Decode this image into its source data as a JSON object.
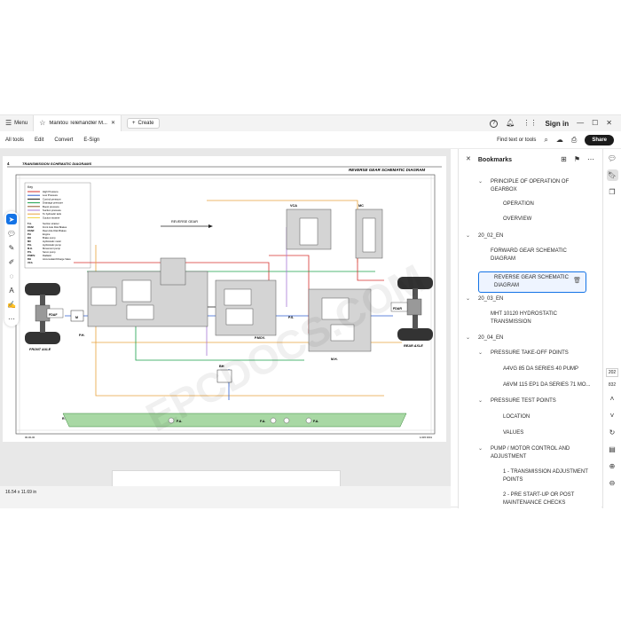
{
  "titlebar": {
    "menu_label": "Menu",
    "tab_title": "Manitou Telehandler M...",
    "create_label": "Create",
    "signin_label": "Sign in"
  },
  "toolbar": {
    "menu_items": [
      "All tools",
      "Edit",
      "Convert",
      "E-Sign"
    ],
    "find_label": "Find text or tools",
    "share_label": "Share"
  },
  "document": {
    "header_left": "TRANSMISSION SCHEMATIC DIAGRAMS",
    "header_num": "4",
    "header_right": "REVERSE GEAR SCHEMATIC DIAGRAM",
    "reverse_gear_label": "REVERSE GEAR",
    "front_axle": "FRONT AXLE",
    "rear_axle": "REAR AXLE",
    "fdaf": "FDAF",
    "fdar": "FDAR",
    "vca": "VCA",
    "mc": "MC",
    "bh": "BH",
    "ph": "P.H.",
    "pmov": "P.MOV.",
    "ps": "P.S.",
    "mh": "M.H.",
    "r": "R.",
    "fa1": "F.A.",
    "fa2": "F.A.",
    "fa3": "F.A.",
    "m": "M",
    "footer_left": "00-00-00",
    "footer_right": "1/445 0001",
    "watermark": "EPCDOCS.COM",
    "key_title": "Key",
    "key_items": [
      {
        "color": "#d6312e",
        "text": "High Pressure"
      },
      {
        "color": "#2f5fd0",
        "text": "Low Pressure"
      },
      {
        "color": "#1a1a1a",
        "text": "Control pressure"
      },
      {
        "color": "#1aa04a",
        "text": "Drainage pressure"
      },
      {
        "color": "#8c5a2b",
        "text": "Boost pressure"
      },
      {
        "color": "#a678d6",
        "text": "Suction pressure"
      },
      {
        "color": "#e7a23c",
        "text": "To hydraulic tank"
      },
      {
        "color": "#f0d23c",
        "text": "Suction strainer"
      }
    ],
    "key_abbrev": [
      "T.A.",
      "FDAF",
      "FDAR",
      "PH",
      "BH",
      "MC",
      "P.H.",
      "M.H.",
      "P.S.",
      "P.MOV.",
      "RH",
      "VCA"
    ],
    "key_abbrev_desc": [
      "Suction strainer",
      "Front Axle Disk Brakes",
      "Rear Axle Disk Brakes",
      "Engine",
      "Brake pump",
      "Hydrostatic motor",
      "Hydrostatic pump",
      "Movement pump",
      "Servo pump",
      "Radiator",
      "Accumulator/Charge Valve",
      ""
    ]
  },
  "sizeinfo": "16.54 x 11.69 in",
  "bookmarks": {
    "title": "Bookmarks",
    "items": [
      {
        "label": "PRINCIPLE OF OPERATION OF GEARBOX",
        "chev": "v",
        "indent": 1
      },
      {
        "label": "OPERATION",
        "chev": "",
        "indent": 2
      },
      {
        "label": "OVERVIEW",
        "chev": "",
        "indent": 2
      },
      {
        "label": "20_02_EN",
        "chev": "v",
        "indent": 0
      },
      {
        "label": "FORWARD GEAR SCHEMATIC DIAGRAM",
        "chev": "",
        "indent": 1
      },
      {
        "label": "REVERSE GEAR SCHEMATIC DIAGRAM",
        "chev": "",
        "indent": 1,
        "selected": true
      },
      {
        "label": "20_03_EN",
        "chev": "v",
        "indent": 0
      },
      {
        "label": "MHT 10120 HYDROSTATIC TRANSMISSION",
        "chev": "",
        "indent": 1
      },
      {
        "label": "20_04_EN",
        "chev": "v",
        "indent": 0
      },
      {
        "label": "PRESSURE TAKE-OFF POINTS",
        "chev": "v",
        "indent": 1
      },
      {
        "label": "A4VG 85 DA SERIES 40 PUMP",
        "chev": "",
        "indent": 2
      },
      {
        "label": "A6VM 115 EP1 DA SERIES 71 MO...",
        "chev": "",
        "indent": 2
      },
      {
        "label": "PRESSURE TEST POINTS",
        "chev": "v",
        "indent": 1
      },
      {
        "label": "LOCATION",
        "chev": "",
        "indent": 2
      },
      {
        "label": "VALUES",
        "chev": "",
        "indent": 2
      },
      {
        "label": "PUMP / MOTOR CONTROL AND ADJUSTMENT",
        "chev": "v",
        "indent": 1
      },
      {
        "label": "1 - TRANSMISSION ADJUSTMENT POINTS",
        "chev": "",
        "indent": 2
      },
      {
        "label": "2 - PRE START-UP OR POST MAINTENANCE CHECKS",
        "chev": "",
        "indent": 2
      }
    ]
  },
  "pager": {
    "current": "202",
    "total": "832"
  },
  "colors": {
    "accent": "#1473e6",
    "high": "#d6312e",
    "low": "#2f5fd0",
    "drain": "#1aa04a",
    "tank": "#e7a23c",
    "yellow": "#f0d23c"
  }
}
